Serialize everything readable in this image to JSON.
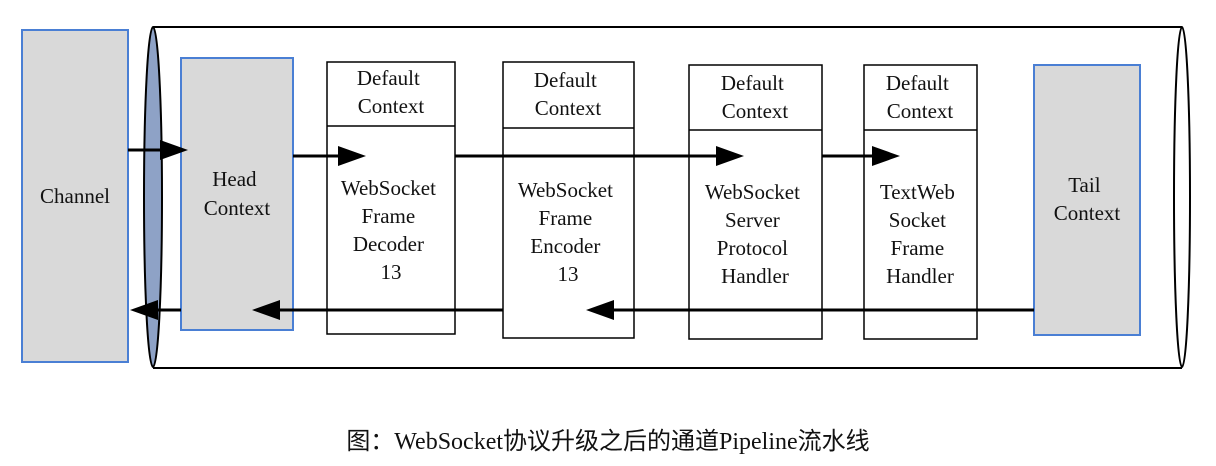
{
  "diagram": {
    "channel": {
      "label": "Channel"
    },
    "head": {
      "lines": [
        "Head",
        "Context"
      ]
    },
    "tail": {
      "lines": [
        "Tail",
        "Context"
      ]
    },
    "handlers": [
      {
        "header": [
          "Default",
          "Context"
        ],
        "body": [
          "WebSocket",
          "Frame",
          "Decoder",
          "13"
        ]
      },
      {
        "header": [
          "Default",
          "Context"
        ],
        "body": [
          "WebSocket",
          "Frame",
          "Encoder",
          "13"
        ]
      },
      {
        "header": [
          "Default",
          "Context"
        ],
        "body": [
          "WebSocket",
          "Server",
          "Protocol",
          "Handler"
        ]
      },
      {
        "header": [
          "Default",
          "Context"
        ],
        "body": [
          "TextWeb",
          "Socket",
          "Frame",
          "Handler"
        ]
      }
    ],
    "caption": "图：WebSocket协议升级之后的通道Pipeline流水线",
    "colors": {
      "context_fill": "#d9d9d9",
      "context_border": "#4a7fd4",
      "ellipse_fill": "#8ea2c6"
    }
  }
}
